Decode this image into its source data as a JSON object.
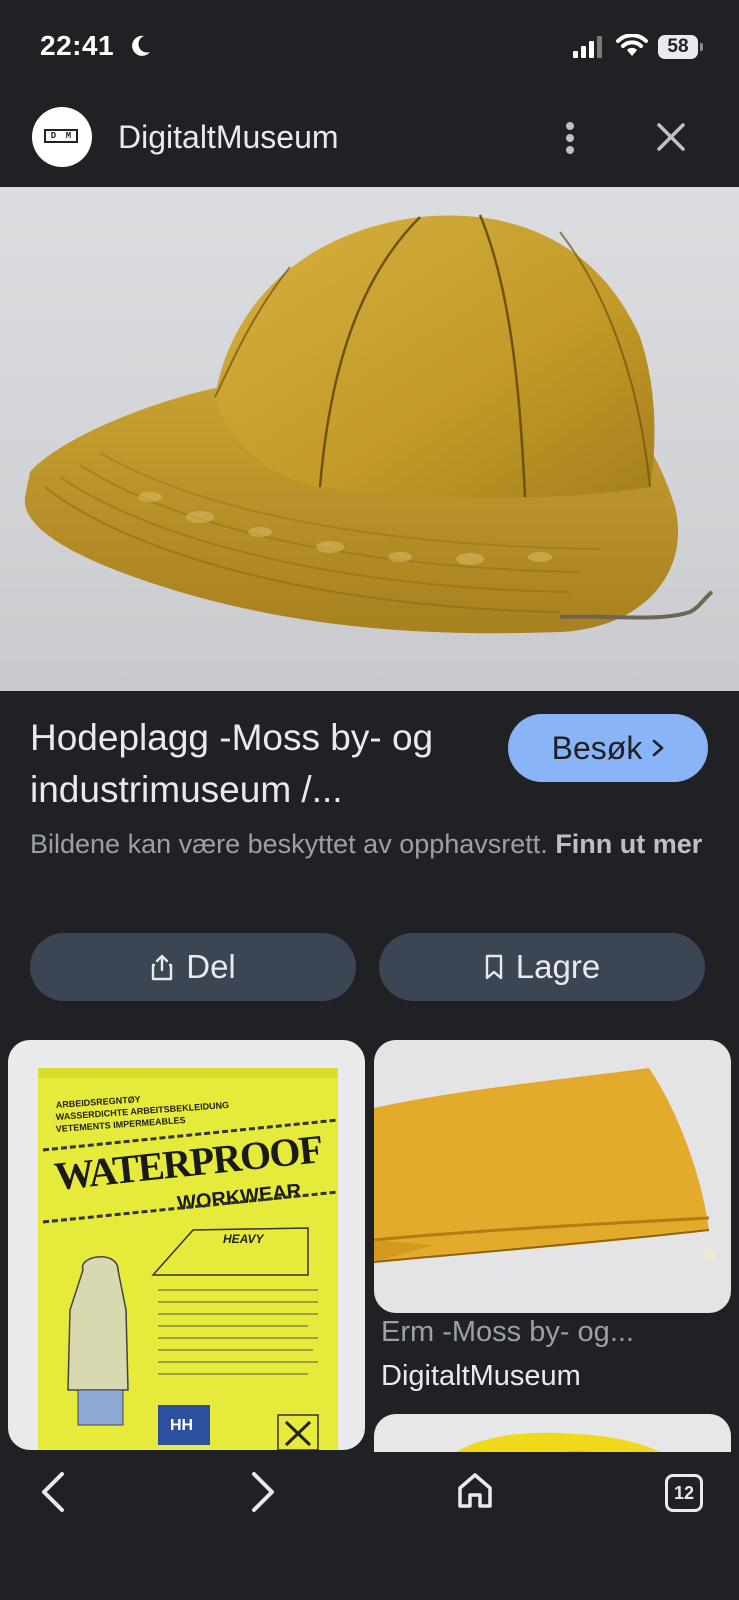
{
  "status_bar": {
    "time": "22:41",
    "battery": "58"
  },
  "header": {
    "site_name": "DigitaltMuseum",
    "logo_letters": [
      "D",
      "M"
    ]
  },
  "result": {
    "title": "Hodeplagg -Moss by- og industrimuseum /...",
    "visit_label": "Besøk",
    "copyright_text": "Bildene kan være beskyttet av opphavsrett.",
    "learn_more": "Finn ut mer",
    "share_label": "Del",
    "save_label": "Lagre"
  },
  "related": {
    "left_image_text": {
      "line1": "ARBEIDSREGNTØY",
      "line2": "WASSERDICHTE ARBEITSBEKLEIDUNG",
      "line3": "VETEMENTS IMPERMEABLES",
      "waterproof": "WATERPROOF",
      "workwear": "WORKWEAR",
      "heavy": "HEAVY",
      "brand": "HH"
    },
    "right_item_title": "Erm -Moss by- og...",
    "right_item_source": "DigitaltMuseum"
  },
  "nav": {
    "tab_count": "12"
  },
  "colors": {
    "background": "#202124",
    "accent": "#8ab4f8",
    "button_bg": "#3c4553",
    "hat_yellow": "#c9a02c"
  },
  "icons": [
    "moon-icon",
    "signal-icon",
    "wifi-icon",
    "more-vert-icon",
    "close-icon",
    "chevron-right-icon",
    "share-icon",
    "bookmark-icon",
    "back-icon",
    "forward-icon",
    "home-icon",
    "tabs-icon"
  ]
}
